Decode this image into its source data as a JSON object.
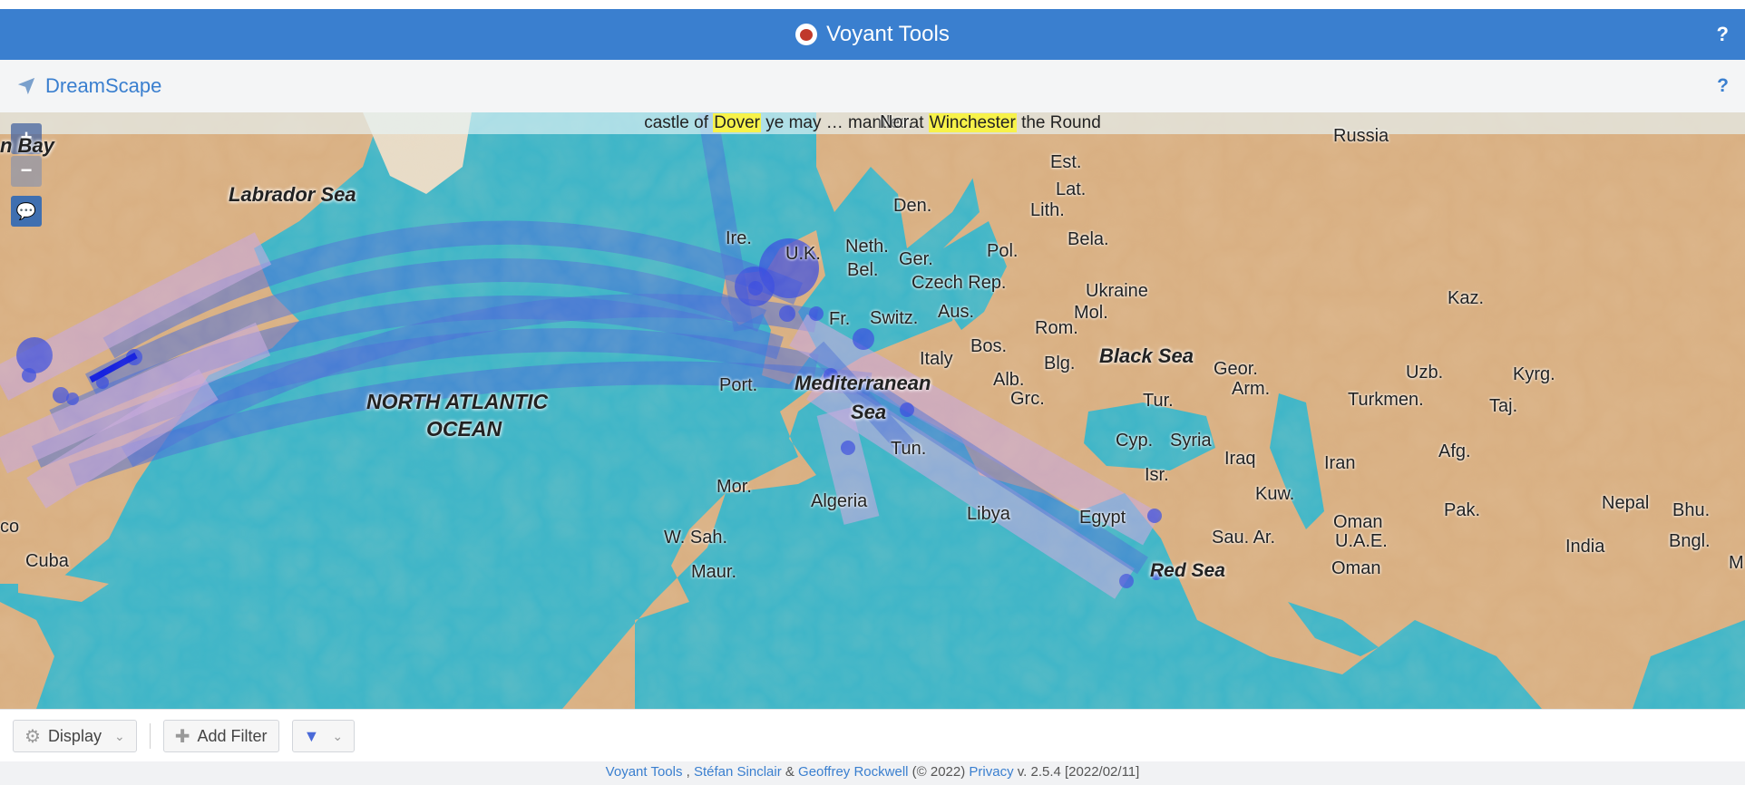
{
  "app": {
    "title": "Voyant Tools",
    "help": "?"
  },
  "panel": {
    "title": "DreamScape",
    "help": "?"
  },
  "map": {
    "caption": {
      "pre": "castle of ",
      "hl1": "Dover",
      "mid": " ye may … mantle: at ",
      "hl2": "Winchester",
      "post": " the Round"
    },
    "zoom_in": "+",
    "zoom_out": "−",
    "labels": {
      "hudson_bay": "n Bay",
      "labrador_sea": "Labrador Sea",
      "north_atlantic_1": "NORTH ATLANTIC",
      "north_atlantic_2": "OCEAN",
      "mediterranean_1": "Mediterranean",
      "mediterranean_2": "Sea",
      "black_sea": "Black Sea",
      "red_sea": "Red Sea",
      "nor": "Nor.",
      "russia": "Russia",
      "est": "Est.",
      "lat": "Lat.",
      "lith": "Lith.",
      "den": "Den.",
      "bela": "Bela.",
      "pol": "Pol.",
      "ger": "Ger.",
      "neth": "Neth.",
      "ire": "Ire.",
      "uk": "U.K.",
      "bel": "Bel.",
      "czech": "Czech Rep.",
      "ukraine": "Ukraine",
      "mol": "Mol.",
      "aus": "Aus.",
      "fr": "Fr.",
      "switz": "Switz.",
      "rom": "Rom.",
      "bos": "Bos.",
      "blg": "Blg.",
      "italy": "Italy",
      "alb": "Alb.",
      "grc": "Grc.",
      "port": "Port.",
      "tur": "Tur.",
      "geor": "Geor.",
      "arm": "Arm.",
      "kaz": "Kaz.",
      "uzb": "Uzb.",
      "kyrg": "Kyrg.",
      "turkmen": "Turkmen.",
      "taj": "Taj.",
      "cyp": "Cyp.",
      "syria": "Syria",
      "iraq": "Iraq",
      "iran": "Iran",
      "afg": "Afg.",
      "isr": "Isr.",
      "kuw": "Kuw.",
      "tun": "Tun.",
      "mor": "Mor.",
      "algeria": "Algeria",
      "libya": "Libya",
      "egypt": "Egypt",
      "sau": "Sau. Ar.",
      "uae": "U.A.E.",
      "oman1": "Oman",
      "oman2": "Oman",
      "pak": "Pak.",
      "nepal": "Nepal",
      "bhu": "Bhu.",
      "india": "India",
      "bngl": "Bngl.",
      "wsah": "W. Sah.",
      "maur": "Maur.",
      "cuba": "Cuba",
      "co": "co",
      "m": "M"
    }
  },
  "toolbar": {
    "display_label": "Display",
    "add_filter_label": "Add Filter"
  },
  "footer": {
    "voyant": "Voyant Tools",
    "comma": " , ",
    "sinclair": "Stéfan Sinclair",
    "amp": " & ",
    "rockwell": "Geoffrey Rockwell",
    "copy": " (© 2022) ",
    "privacy": "Privacy",
    "version": " v. 2.5.4 [2022/02/11]"
  },
  "colors": {
    "header": "#3a7fcf",
    "sea": "#3fb6c8",
    "land": "#d9b083",
    "arc": "#4a6fd8",
    "point": "#3b4fe0"
  }
}
